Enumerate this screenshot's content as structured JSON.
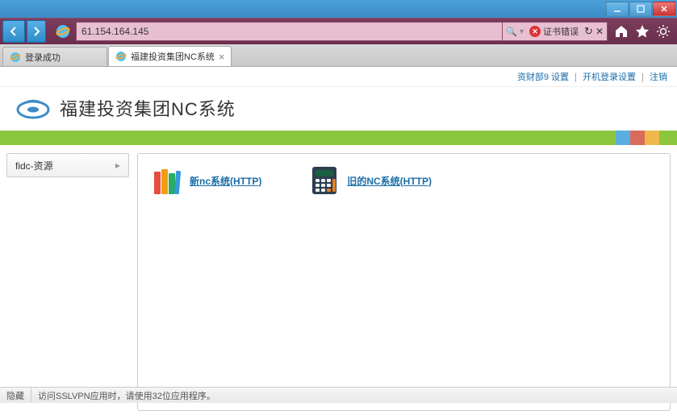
{
  "window": {
    "minimize": "─",
    "maximize": "☐",
    "close": "✕"
  },
  "nav": {
    "url": "61.154.164.145",
    "search_hint": "🔍",
    "cert_error": "证书错误",
    "refresh": "↻",
    "stop": "✕"
  },
  "tabs": [
    {
      "title": "登录成功",
      "active": false
    },
    {
      "title": "福建投资集团NC系统",
      "active": true
    }
  ],
  "top_links": {
    "user": "资财部9",
    "settings": "设置",
    "startup": "开机登录设置",
    "logout": "注销"
  },
  "header": {
    "title": "福建投资集团NC系统"
  },
  "colorbar": {
    "colors": [
      "#5aaee0",
      "#d96b5c",
      "#f0b84c",
      "#8cc63f"
    ]
  },
  "sidebar": {
    "items": [
      {
        "label": "fidc-资源"
      }
    ]
  },
  "resources": [
    {
      "label": "新nc系统(HTTP)",
      "icon": "books"
    },
    {
      "label": "旧的NC系统(HTTP)",
      "icon": "calculator"
    }
  ],
  "status": {
    "hide": "隐藏",
    "message": "访问SSLVPN应用时，请使用32位应用程序。"
  }
}
